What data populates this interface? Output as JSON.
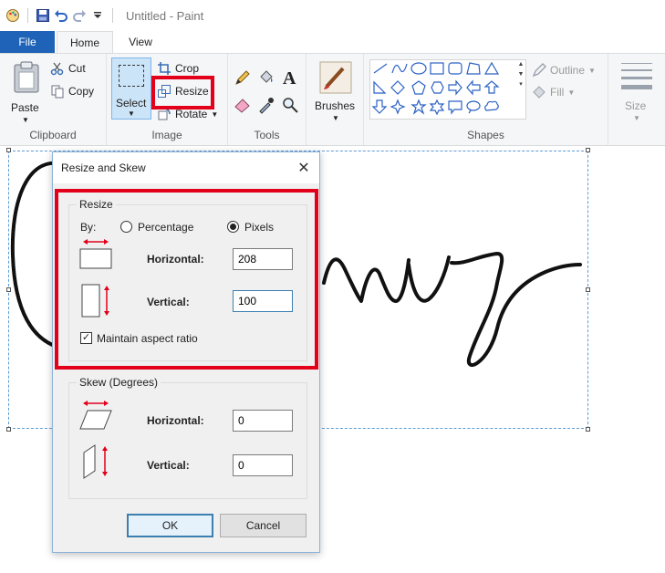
{
  "window": {
    "title": "Untitled - Paint"
  },
  "tabs": {
    "file": "File",
    "home": "Home",
    "view": "View"
  },
  "clipboard": {
    "paste": "Paste",
    "cut": "Cut",
    "copy": "Copy",
    "label": "Clipboard"
  },
  "image": {
    "select": "Select",
    "crop": "Crop",
    "resize": "Resize",
    "rotate": "Rotate",
    "label": "Image"
  },
  "tools": {
    "label": "Tools"
  },
  "brushes": {
    "label": "Brushes"
  },
  "shapes": {
    "label": "Shapes",
    "outline": "Outline",
    "fill": "Fill"
  },
  "size": {
    "label": "Size"
  },
  "dialog": {
    "title": "Resize and Skew",
    "resize_legend": "Resize",
    "by": "By:",
    "percentage": "Percentage",
    "pixels": "Pixels",
    "horizontal_label": "Horizontal:",
    "horizontal_value": "208",
    "vertical_label": "Vertical:",
    "vertical_value": "100",
    "maintain": "Maintain aspect ratio",
    "skew_legend": "Skew (Degrees)",
    "skew_h_label": "Horizontal:",
    "skew_h_value": "0",
    "skew_v_label": "Vertical:",
    "skew_v_value": "0",
    "ok": "OK",
    "cancel": "Cancel"
  },
  "colors": {
    "accent": "#1e63b7",
    "highlight": "#e2001a"
  }
}
